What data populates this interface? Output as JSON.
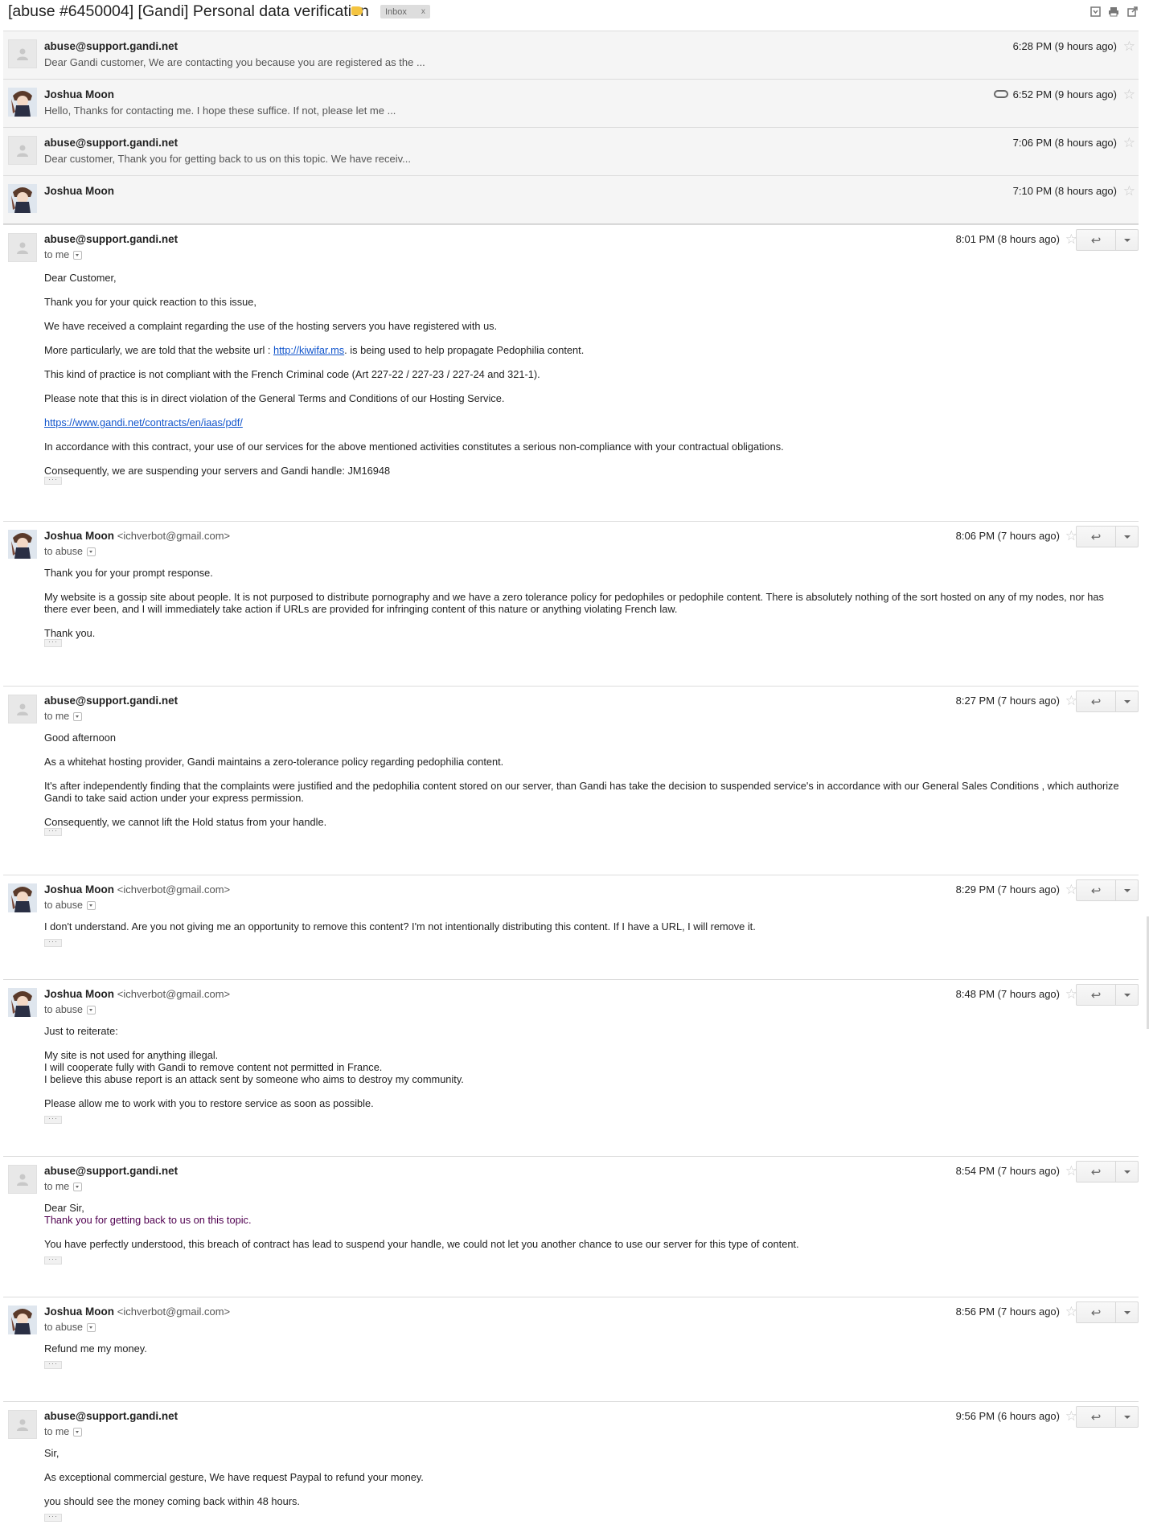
{
  "header": {
    "subject": "[abuse #6450004] [Gandi] Personal data verification",
    "label": "Inbox",
    "label_close": "x",
    "icons": [
      "expand-all-icon",
      "print-icon",
      "new-window-icon"
    ]
  },
  "collapsed": [
    {
      "sender": "abuse@support.gandi.net",
      "snippet": "Dear Gandi customer, We are contacting you because you are registered as the ...",
      "time": "6:28 PM (9 hours ago)",
      "avatar": "default-avatar",
      "attachment": false
    },
    {
      "sender": "Joshua Moon",
      "snippet": "Hello, Thanks for contacting me. I hope these suffice. If not, please let me ...",
      "time": "6:52 PM (9 hours ago)",
      "avatar": "photo-avatar",
      "attachment": true
    },
    {
      "sender": "abuse@support.gandi.net",
      "snippet": "Dear customer, Thank you for getting back to us on this topic. We have receiv...",
      "time": "7:06 PM (8 hours ago)",
      "avatar": "default-avatar",
      "attachment": false
    },
    {
      "sender": "Joshua Moon",
      "snippet": "",
      "time": "7:10 PM (8 hours ago)",
      "avatar": "photo-avatar",
      "attachment": false
    }
  ],
  "messages": [
    {
      "sender": "abuse@support.gandi.net",
      "email": "",
      "recipient": "to me",
      "time": "8:01 PM (8 hours ago)",
      "greeting": "Dear Customer,",
      "p1": "Thank you for your quick reaction to this issue,",
      "p2": "We have received a complaint regarding the use of the hosting servers you have registered with us.",
      "p3_a": "More particularly, we are told that the website url : ",
      "p3_link": "http://kiwifar.ms",
      "p3_b": ". is being used to help propagate Pedophilia content.",
      "p4": "This kind of practice is not compliant with the French Criminal code (Art 227-22 / 227-23 / 227-24 and 321-1).",
      "p5": "Please note that this is in direct violation of the General Terms and Conditions of our Hosting Service.",
      "p6_link": "https://www.gandi.net/contracts/en/iaas/pdf/",
      "p7": "In accordance with this contract, your use of our services for the above mentioned activities constitutes a serious non-compliance with your contractual obligations.",
      "p8": "Consequently, we are suspending your servers and Gandi handle: JM16948"
    },
    {
      "sender": "Joshua Moon",
      "email": "<ichverbot@gmail.com>",
      "recipient": "to abuse",
      "time": "8:06 PM (7 hours ago)",
      "p1": "Thank you for your prompt response.",
      "p2": "My website is a gossip site about people. It is not purposed to distribute pornography and we have a zero tolerance policy for pedophiles or pedophile content. There is absolutely nothing of the sort hosted on any of my nodes, nor has there ever been, and I will immediately take action if URLs are provided for infringing content of this nature or anything violating French law.",
      "p3": "Thank you."
    },
    {
      "sender": "abuse@support.gandi.net",
      "email": "",
      "recipient": "to me",
      "time": "8:27 PM (7 hours ago)",
      "p1": "Good afternoon",
      "p2": "As a whitehat hosting provider, Gandi maintains a zero-tolerance policy regarding pedophilia content.",
      "p3": "It's after independently finding that the complaints were justified and the pedophilia content stored on our server, than Gandi has take the decision to suspended service's in accordance with our General Sales Conditions , which authorize Gandi to take said action under your express permission.",
      "p4": "Consequently, we cannot lift the Hold status from your handle."
    },
    {
      "sender": "Joshua Moon",
      "email": "<ichverbot@gmail.com>",
      "recipient": "to abuse",
      "time": "8:29 PM (7 hours ago)",
      "p1": "I don't understand. Are you not giving me an opportunity to remove this content? I'm not intentionally distributing this content. If I have a URL, I will remove it."
    },
    {
      "sender": "Joshua Moon",
      "email": "<ichverbot@gmail.com>",
      "recipient": "to abuse",
      "time": "8:48 PM (7 hours ago)",
      "p1": "Just to reiterate:",
      "l1": "My site is not used for anything illegal.",
      "l2": "I will cooperate fully with Gandi to remove content not permitted in France.",
      "l3": "I believe this abuse report is an attack sent by someone who aims to destroy my community.",
      "p2": "Please allow me to work with you to restore service as soon as possible."
    },
    {
      "sender": "abuse@support.gandi.net",
      "email": "",
      "recipient": "to me",
      "time": "8:54 PM (7 hours ago)",
      "p1": "Dear Sir,",
      "p2": "Thank you for getting back to us on this topic.",
      "p3": "You have perfectly understood, this breach of contract has lead to suspend your handle, we could not let you another chance to use our server for this type of content."
    },
    {
      "sender": "Joshua Moon",
      "email": "<ichverbot@gmail.com>",
      "recipient": "to abuse",
      "time": "8:56 PM (7 hours ago)",
      "p1": "Refund me my money."
    },
    {
      "sender": "abuse@support.gandi.net",
      "email": "",
      "recipient": "to me",
      "time": "9:56 PM (6 hours ago)",
      "p1": "Sir,",
      "p2": "As exceptional commercial gesture, We have request Paypal to refund your money.",
      "p3": "you should see the money coming back within 48 hours."
    }
  ],
  "ellipsis": "···",
  "star_glyph": "☆",
  "reply_glyph": "↩",
  "colors": {
    "label_yellow": "#f4c440",
    "link": "#1155cc",
    "quoted_purple": "#500050"
  }
}
